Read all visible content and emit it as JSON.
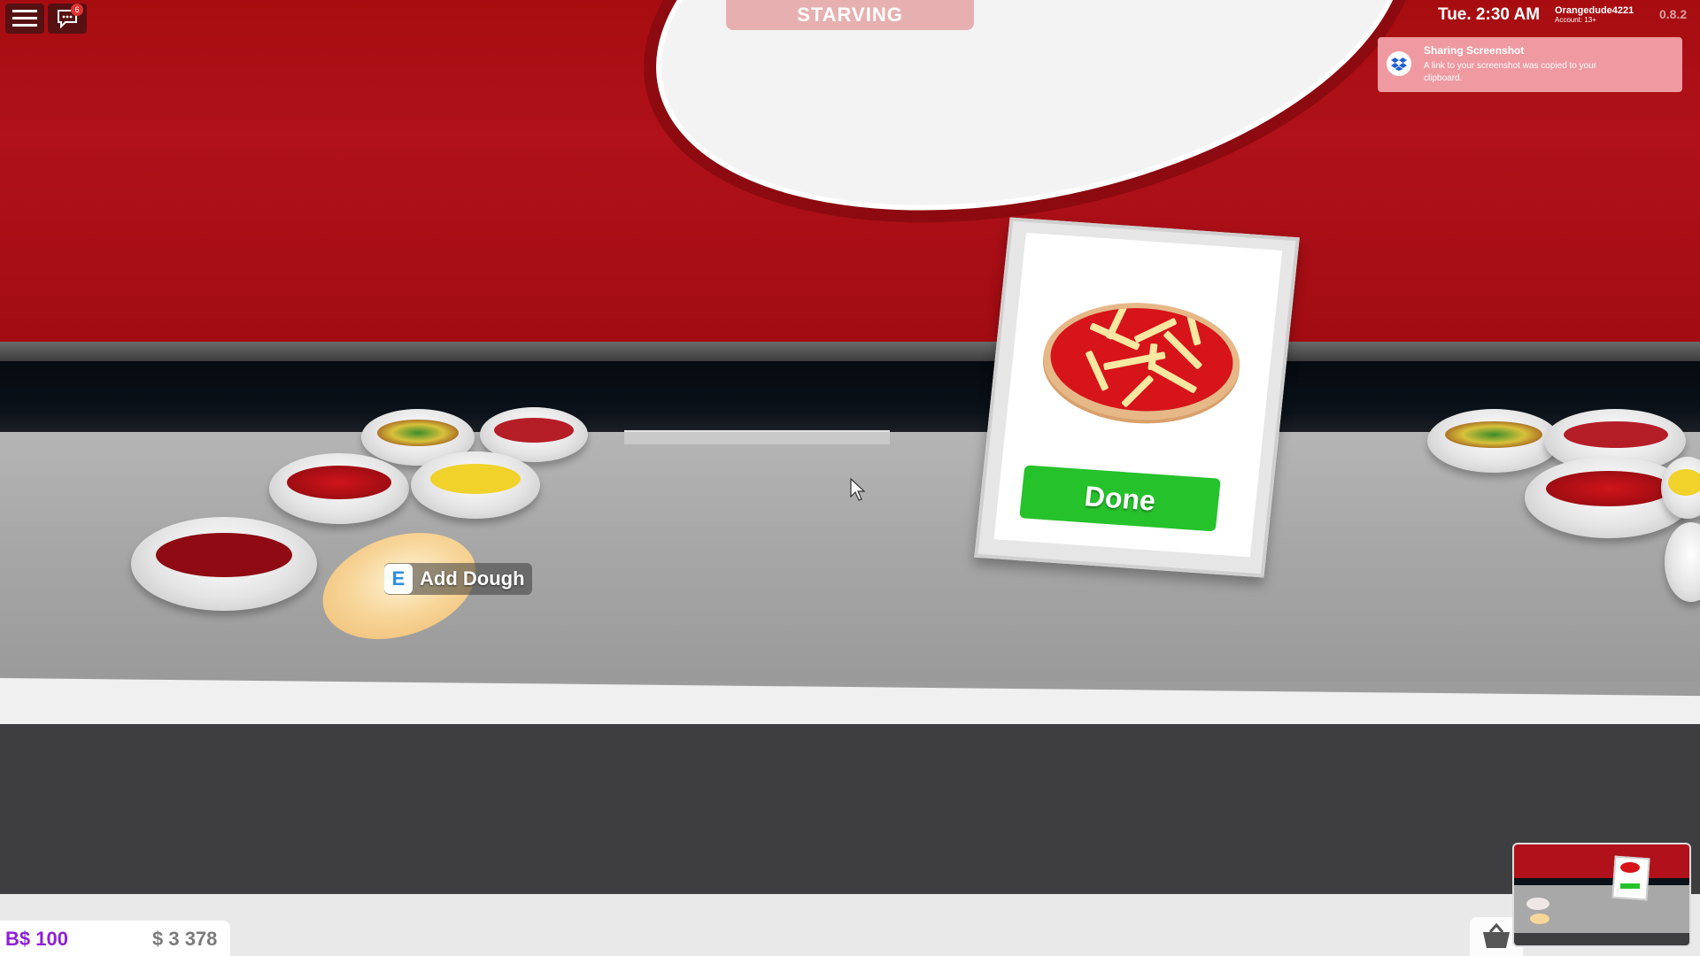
{
  "hud": {
    "status": "STARVING",
    "chat_badge": "6",
    "clock": "Tue. 2:30 AM",
    "account_name": "Orangedude4221",
    "account_age": "Account: 13+",
    "version": "0.8.2"
  },
  "notification": {
    "title": "Sharing Screenshot",
    "message": "A link to your screenshot was copied to your clipboard."
  },
  "prompt": {
    "key": "E",
    "label": "Add Dough"
  },
  "order_card": {
    "done_label": "Done"
  },
  "currency": {
    "bucks": "B$ 100",
    "cash": "$ 3 378"
  },
  "icons": {
    "menu": "hamburger-icon",
    "chat": "chat-icon",
    "notification": "dropbox-icon",
    "shop": "basket-icon",
    "cursor": "arrow-cursor-icon"
  },
  "colors": {
    "wall": "#b0111a",
    "status_pill": "#dc7878",
    "toast": "#ee9aa0",
    "done_button": "#25c22c",
    "bucks": "#8f1fd6",
    "cash": "#7b7b7b"
  }
}
